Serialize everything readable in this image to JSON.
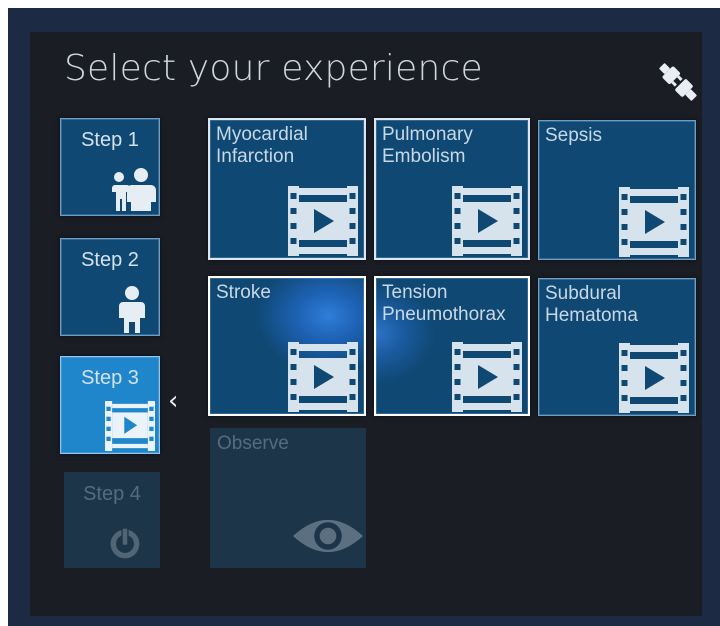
{
  "title": "Select your experience",
  "icons": {
    "connect": "plug-connect-icon",
    "back": "chevron-left-icon",
    "video": "film-play-icon",
    "observe": "eye-icon",
    "power": "power-icon"
  },
  "steps": [
    {
      "label": "Step 1",
      "icon": "people-icon",
      "state": "normal"
    },
    {
      "label": "Step 2",
      "icon": "person-icon",
      "state": "normal"
    },
    {
      "label": "Step 3",
      "icon": "film-play-icon",
      "state": "active"
    },
    {
      "label": "Step 4",
      "icon": "power-icon",
      "state": "disabled"
    }
  ],
  "experiences": [
    {
      "label": "Myocardial\nInfarction",
      "state": "framed"
    },
    {
      "label": "Pulmonary\nEmbolism",
      "state": "framed"
    },
    {
      "label": "Sepsis",
      "state": "normal"
    },
    {
      "label": "Stroke",
      "state": "selected"
    },
    {
      "label": "Tension\nPneumothorax",
      "state": "hover"
    },
    {
      "label": "Subdural\nHematoma",
      "state": "normal"
    }
  ],
  "observe": {
    "label": "Observe",
    "state": "disabled"
  },
  "colors": {
    "tile": "#0f4873",
    "tile_active": "#1f86cc",
    "panel": "#1a1d24",
    "frame": "#1c2a44",
    "text": "#c8d8e6"
  }
}
